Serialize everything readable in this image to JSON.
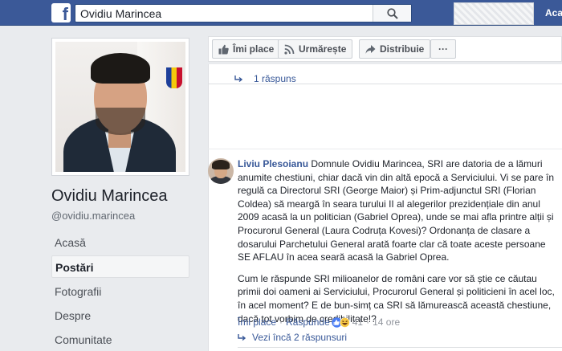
{
  "topbar": {
    "search_value": "Ovidiu Marincea",
    "nav_home_label": "Acasă",
    "logo_letter": "f",
    "brand_color": "#3b5998"
  },
  "profile": {
    "name": "Ovidiu Marincea",
    "handle": "@ovidiu.marincea"
  },
  "nav": {
    "items": [
      {
        "label": "Acasă",
        "active": false
      },
      {
        "label": "Postări",
        "active": true
      },
      {
        "label": "Fotografii",
        "active": false
      },
      {
        "label": "Despre",
        "active": false
      },
      {
        "label": "Comunitate",
        "active": false
      }
    ]
  },
  "actions": {
    "like_label": "Îmi place",
    "follow_label": "Urmărește",
    "share_label": "Distribuie",
    "more_label": "···"
  },
  "thread": {
    "replies_label": "1 răspuns"
  },
  "comment": {
    "author": "Liviu Plesoianu",
    "paragraph1": "Domnule Ovidiu Marincea, SRI are datoria de a lămuri anumite chestiuni, chiar dacă vin din altă epocă a Serviciului. Vi se pare în regulă ca Directorul SRI (George Maior) și Prim-adjunctul SRI (Florian Coldea) să meargă în seara turului II al alegerilor prezidențiale din anul 2009 acasă la un politician (Gabriel Oprea), unde se mai afla printre alții și Procurorul General (Laura Codruța Kovesi)? Ordonanța de clasare a dosarului Parchetului General arată foarte clar că toate aceste persoane SE AFLAU în acea seară acasă la Gabriel Oprea.",
    "paragraph2": "Cum le răspunde SRI milioanelor de români care vor să știe ce căutau primii doi oameni ai Serviciului, Procurorul General și politicieni în acel loc, în acel moment? E de bun-simț ca SRI să lămurească această chestiune, dacă tot vorbim de credibilitate!?",
    "like_label": "Îmi place",
    "reply_label": "Răspunde",
    "reaction_count": "41",
    "timestamp": "14 ore",
    "more_replies_label": "Vezi încă 2 răspunsuri"
  }
}
